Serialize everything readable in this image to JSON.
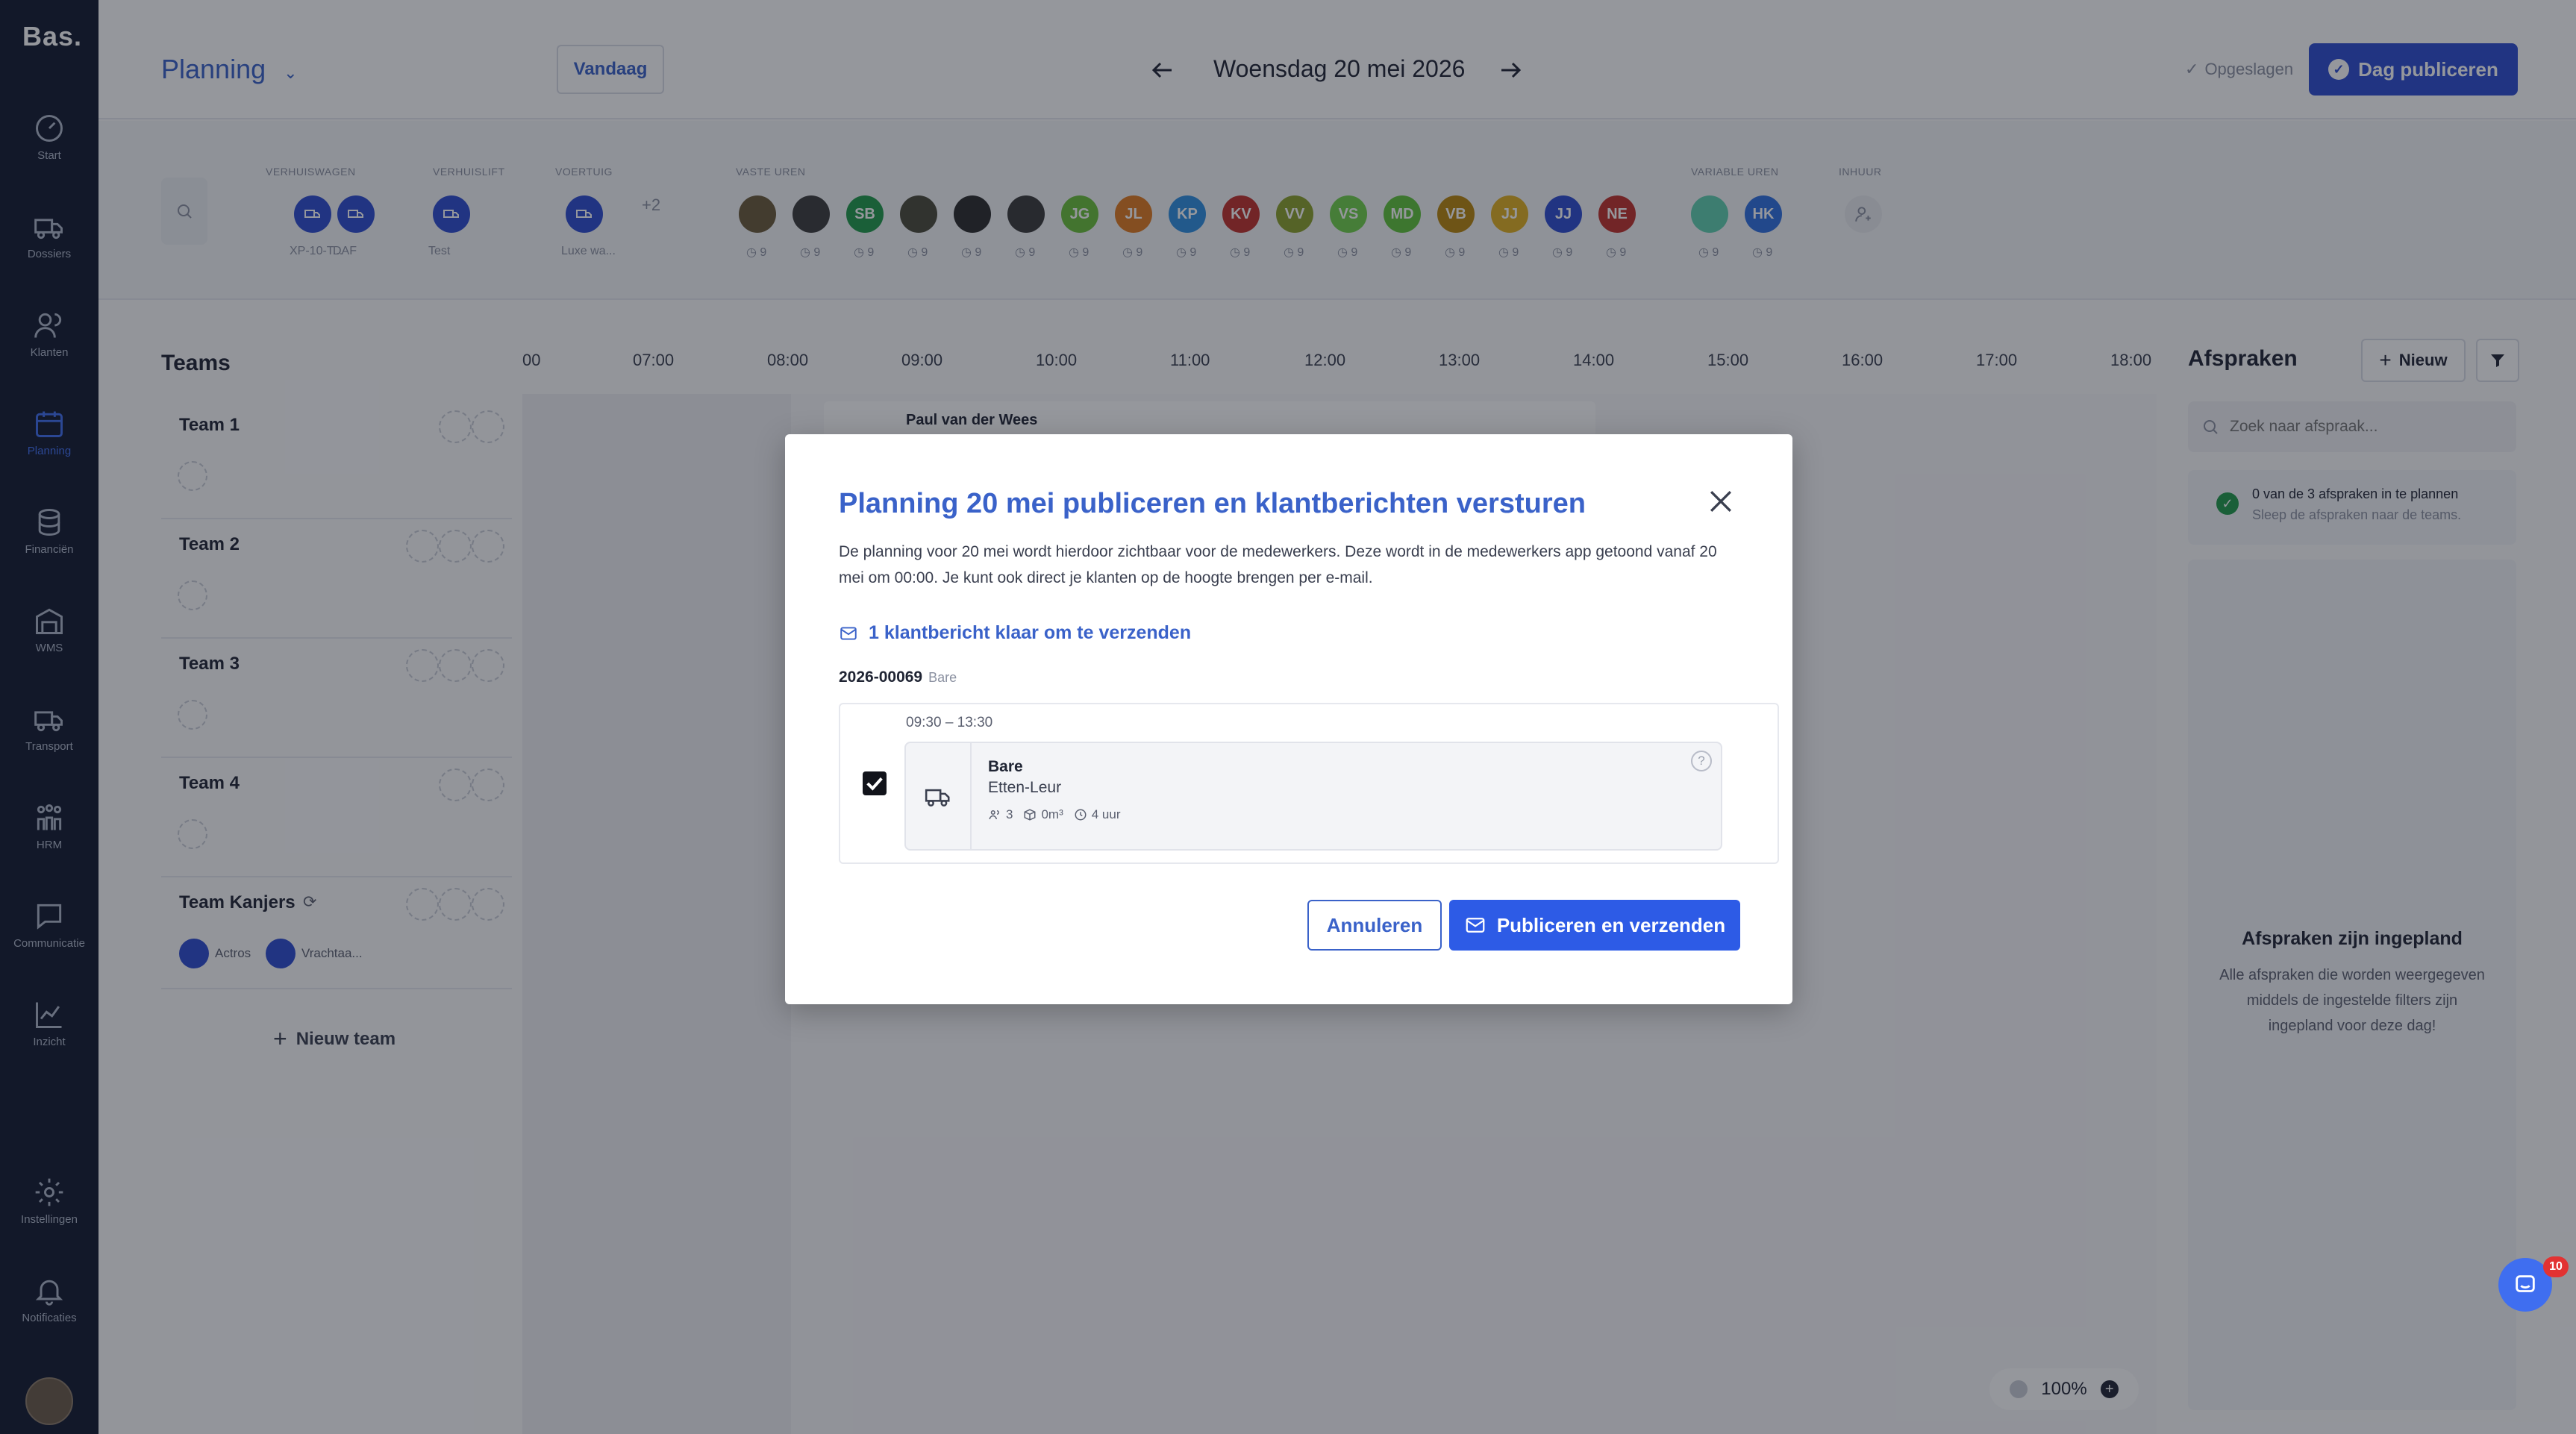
{
  "app": {
    "logo": "Bas."
  },
  "sidebar": {
    "items": [
      {
        "label": "Start",
        "icon": "dashboard-icon"
      },
      {
        "label": "Dossiers",
        "icon": "truck-icon"
      },
      {
        "label": "Klanten",
        "icon": "users-icon"
      },
      {
        "label": "Planning",
        "icon": "calendar-icon",
        "active": true
      },
      {
        "label": "Financiën",
        "icon": "coins-icon"
      },
      {
        "label": "WMS",
        "icon": "warehouse-icon"
      },
      {
        "label": "Transport",
        "icon": "truck-icon"
      },
      {
        "label": "HRM",
        "icon": "team-icon"
      },
      {
        "label": "Communicatie",
        "icon": "chat-icon"
      },
      {
        "label": "Inzicht",
        "icon": "chart-icon"
      },
      {
        "label": "Instellingen",
        "icon": "gear-icon"
      },
      {
        "label": "Notificaties",
        "icon": "bell-icon"
      }
    ]
  },
  "header": {
    "title": "Planning",
    "today_label": "Vandaag",
    "date": "Woensdag 20 mei 2026",
    "saved_label": "Opgeslagen",
    "publish_label": "Dag publiceren"
  },
  "resources": {
    "groups": {
      "verhuiswagen": "VERHUISWAGEN",
      "verhuislift": "VERHUISLIFT",
      "voertuig": "VOERTUIG",
      "vaste_uren": "VASTE UREN",
      "variabele_uren": "VARIABLE UREN",
      "inhuur": "INHUUR"
    },
    "vehicles": [
      {
        "label": "XP-10-T..."
      },
      {
        "label": "DAF"
      },
      {
        "label": "Test"
      },
      {
        "label": "Luxe wa..."
      }
    ],
    "more_vehicles": "+2",
    "fixed_staff": [
      {
        "initials": "",
        "color": "#6a5a3a",
        "hours": "9"
      },
      {
        "initials": "",
        "color": "#3b3b3b",
        "hours": "9"
      },
      {
        "initials": "SB",
        "color": "#1f9a4a",
        "hours": "9"
      },
      {
        "initials": "",
        "color": "#4a4a3a",
        "hours": "9"
      },
      {
        "initials": "",
        "color": "#2b2b2b",
        "hours": "9"
      },
      {
        "initials": "",
        "color": "#3a3a3a",
        "hours": "9"
      },
      {
        "initials": "JG",
        "color": "#6bbf3a",
        "hours": "9"
      },
      {
        "initials": "JL",
        "color": "#e07a1f",
        "hours": "9"
      },
      {
        "initials": "KP",
        "color": "#2f8fe0",
        "hours": "9"
      },
      {
        "initials": "KV",
        "color": "#c0302a",
        "hours": "9"
      },
      {
        "initials": "VV",
        "color": "#8aa12a",
        "hours": "9"
      },
      {
        "initials": "VS",
        "color": "#6fcf4a",
        "hours": "9"
      },
      {
        "initials": "MD",
        "color": "#5fc43a",
        "hours": "9"
      },
      {
        "initials": "VB",
        "color": "#b8860b",
        "hours": "9"
      },
      {
        "initials": "JJ",
        "color": "#e0b020",
        "hours": "9"
      },
      {
        "initials": "JJ",
        "color": "#2d4bd0",
        "hours": "9"
      },
      {
        "initials": "NE",
        "color": "#c0302a",
        "hours": "9"
      }
    ],
    "variable_staff": [
      {
        "initials": "",
        "color": "#5fd0b0",
        "hours": "9"
      },
      {
        "initials": "HK",
        "color": "#2f6fe0",
        "hours": "9"
      }
    ]
  },
  "teams": {
    "heading": "Teams",
    "list": [
      {
        "name": "Team 1"
      },
      {
        "name": "Team 2"
      },
      {
        "name": "Team 3"
      },
      {
        "name": "Team 4"
      },
      {
        "name": "Team Kanjers",
        "vehicles": [
          "Actros",
          "Vrachtaa..."
        ]
      }
    ],
    "new_team": "Nieuw team"
  },
  "timeline": {
    "hours": [
      "00",
      "07:00",
      "08:00",
      "09:00",
      "10:00",
      "11:00",
      "12:00",
      "13:00",
      "14:00",
      "15:00",
      "16:00",
      "17:00",
      "18:00"
    ],
    "event_title": "Paul van der Wees",
    "zoom": "100%"
  },
  "appointments": {
    "title": "Afspraken",
    "new_label": "Nieuw",
    "search_placeholder": "Zoek naar afspraak...",
    "status_text": "0 van de 3 afspraken in te plannen",
    "status_sub": "Sleep de afspraken naar de teams.",
    "empty_title": "Afspraken zijn ingepland",
    "empty_text": "Alle afspraken die worden weergegeven middels de ingestelde filters zijn ingepland voor deze dag!"
  },
  "modal": {
    "title": "Planning 20 mei publiceren en klantberichten versturen",
    "description": "De planning voor 20 mei wordt hierdoor zichtbaar voor de medewerkers. Deze wordt in de medewerkers app getoond vanaf 20 mei om 00:00. Je kunt ook direct je klanten op de hoogte brengen per e-mail.",
    "messages_link": "1 klantbericht klaar om te verzenden",
    "dossier_number": "2026-00069",
    "dossier_name": "Bare",
    "appointment": {
      "time": "09:30 – 13:30",
      "checked": true,
      "name": "Bare",
      "place": "Etten-Leur",
      "people": "3",
      "volume": "0m³",
      "duration": "4 uur"
    },
    "cancel_label": "Annuleren",
    "publish_label": "Publiceren en verzenden"
  },
  "chat": {
    "badge": "10"
  }
}
